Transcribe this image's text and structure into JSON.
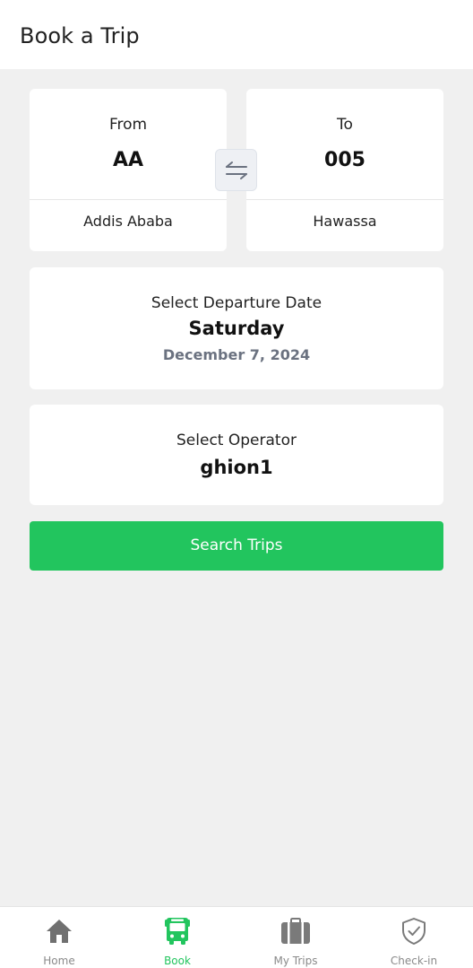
{
  "header": {
    "title": "Book a Trip"
  },
  "route": {
    "from": {
      "label": "From",
      "code": "AA",
      "city": "Addis Ababa"
    },
    "to": {
      "label": "To",
      "code": "005",
      "city": "Hawassa"
    },
    "swap_icon": "swap-arrows-icon"
  },
  "departure": {
    "label": "Select Departure Date",
    "day": "Saturday",
    "date": "December 7, 2024"
  },
  "operator": {
    "label": "Select Operator",
    "value": "ghion1"
  },
  "search_button": {
    "label": "Search Trips"
  },
  "bottom_nav": {
    "items": [
      {
        "label": "Home",
        "icon": "home-icon",
        "active": false
      },
      {
        "label": "Book",
        "icon": "bus-icon",
        "active": true
      },
      {
        "label": "My Trips",
        "icon": "briefcase-icon",
        "active": false
      },
      {
        "label": "Check-in",
        "icon": "shield-check-icon",
        "active": false
      }
    ]
  },
  "colors": {
    "accent": "#22c55e",
    "background": "#f0f0f0",
    "card": "#ffffff",
    "muted_text": "#6b7280",
    "inactive_nav": "#8a8a8a"
  }
}
